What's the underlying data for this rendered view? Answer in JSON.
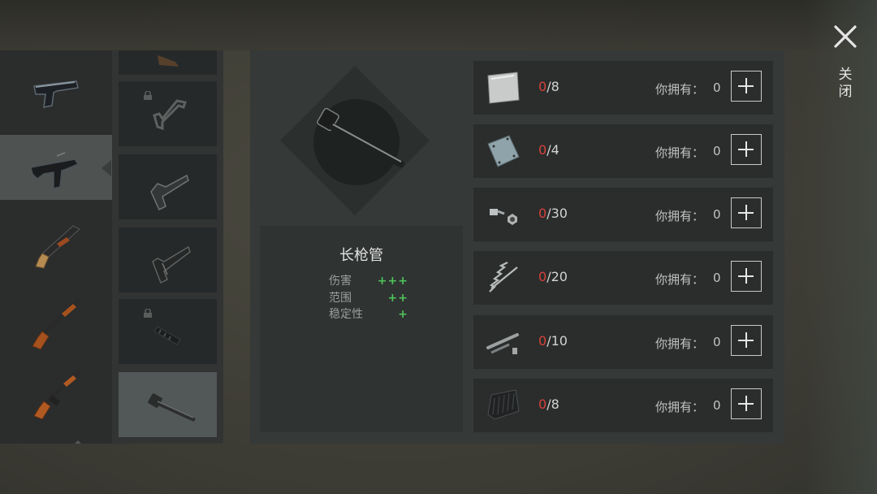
{
  "part": {
    "name": "长枪管",
    "stats": [
      {
        "label": "伤害",
        "value": "+++"
      },
      {
        "label": "范围",
        "value": "++"
      },
      {
        "label": "稳定性",
        "value": "+"
      }
    ]
  },
  "materials": [
    {
      "icon": "steel-plate-icon",
      "need": "0",
      "total": "/8",
      "own_label": "你拥有：",
      "own": "0"
    },
    {
      "icon": "metal-sheet-icon",
      "need": "0",
      "total": "/4",
      "own_label": "你拥有：",
      "own": "0"
    },
    {
      "icon": "bolt-nut-icon",
      "need": "0",
      "total": "/30",
      "own_label": "你拥有：",
      "own": "0"
    },
    {
      "icon": "spring-icon",
      "need": "0",
      "total": "/20",
      "own_label": "你拥有：",
      "own": "0"
    },
    {
      "icon": "pipe-parts-icon",
      "need": "0",
      "total": "/10",
      "own_label": "你拥有：",
      "own": "0"
    },
    {
      "icon": "rubber-sheet-icon",
      "need": "0",
      "total": "/8",
      "own_label": "你拥有：",
      "own": "0"
    }
  ],
  "close_label": "关闭",
  "weapons": [
    "pistol-icon",
    "uzi-icon",
    "shotgun-icon",
    "hunting-rifle-icon",
    "ak47-icon"
  ],
  "attachments": [
    "stock-locked-icon",
    "wire-stock-icon",
    "folding-stock-icon",
    "tactical-stock-icon",
    "grip-locked-icon",
    "long-barrel-icon"
  ],
  "colors": {
    "need": "#d8403a",
    "stat_plus": "#4fc35a"
  }
}
